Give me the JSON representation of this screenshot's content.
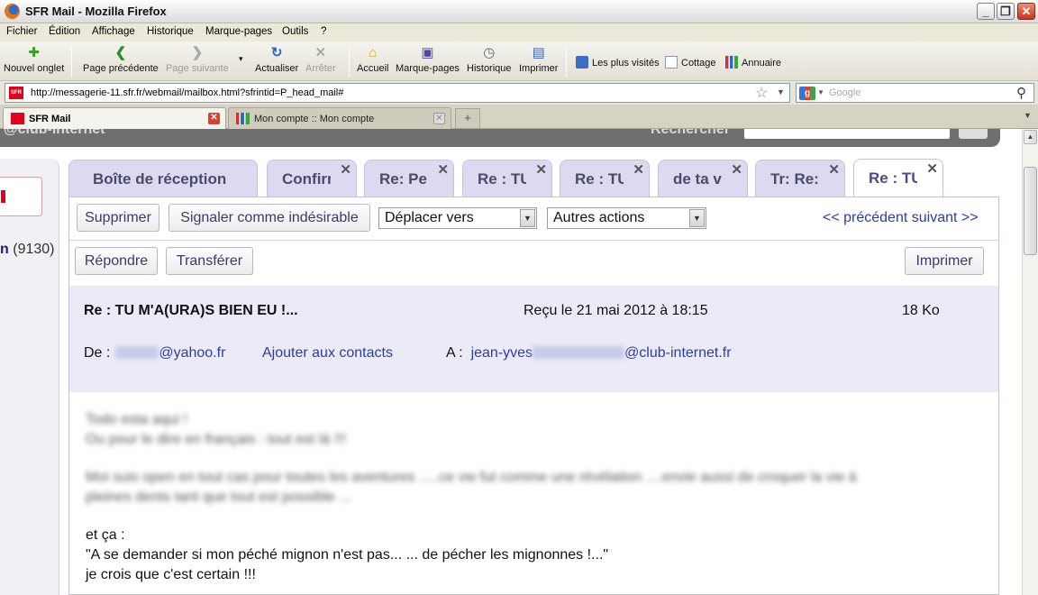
{
  "window": {
    "title": "SFR Mail - Mozilla Firefox",
    "min_label": "_",
    "max_label": "❐",
    "close_label": "✕"
  },
  "menu": {
    "items": [
      "Fichier",
      "Édition",
      "Affichage",
      "Historique",
      "Marque-pages",
      "Outils",
      "?"
    ]
  },
  "toolbar": {
    "new_tab": "Nouvel onglet",
    "back": "Page précédente",
    "forward": "Page suivante",
    "reload": "Actualiser",
    "stop": "Arrêter",
    "home": "Accueil",
    "bookmarks": "Marque-pages",
    "history": "Historique",
    "print": "Imprimer",
    "bookmarks_bar": [
      "Les plus visités",
      "Cottage",
      "Annuaire"
    ]
  },
  "urlbar": {
    "url": "http://messagerie-11.sfr.fr/webmail/mailbox.html?sfrintid=P_head_mail#",
    "search_placeholder": "Google"
  },
  "browser_tabs": [
    {
      "label": "SFR Mail",
      "active": true
    },
    {
      "label": "Mon compte :: Mon compte",
      "active": false
    }
  ],
  "sidebar": {
    "inbox_label": "n",
    "inbox_count": "(9130)"
  },
  "mail_tabs": [
    {
      "label": "Boîte de réception",
      "closable": false
    },
    {
      "label": "Confirm",
      "closable": true
    },
    {
      "label": "Re: Pers",
      "closable": true
    },
    {
      "label": "Re : TU",
      "closable": true
    },
    {
      "label": "Re : TU",
      "closable": true
    },
    {
      "label": "de ta vi",
      "closable": true
    },
    {
      "label": "Tr: Re:",
      "closable": true
    },
    {
      "label": "Re : TU",
      "closable": true,
      "current": true
    }
  ],
  "actions": {
    "delete": "Supprimer",
    "spam": "Signaler comme indésirable",
    "move_to": "Déplacer vers",
    "other_actions": "Autres actions",
    "prev_next": "<< précédent suivant >>",
    "reply": "Répondre",
    "forward": "Transférer",
    "print": "Imprimer"
  },
  "message": {
    "subject": "Re : TU M'A(URA)S BIEN EU !...",
    "received": "Reçu le 21 mai 2012 à 18:15",
    "size": "18 Ko",
    "from_label": "De :",
    "from_domain": "@yahoo.fr",
    "add_contact": "Ajouter aux contacts",
    "to_label": "A :",
    "to_prefix": "jean-yves",
    "to_domain": "@club-internet.fr",
    "blurred_lines": [
      "Todo esta aqui !",
      "Ou pour le dire en français : tout est là !!!",
      "Moi suis open en tout cas pour toutes les aventures .....ce vw fut comme une révélation ....envie aussi de croquer la vie à",
      "pleines dents tant que tout est possible ..."
    ],
    "lines": [
      "et ça :",
      "\"A se demander si mon péché mignon n'est pas... ... de pécher les mignonnes !...\"",
      "je crois que c'est certain !!!"
    ]
  },
  "colors": {
    "accent": "#2a3ea8",
    "header_bg": "#ebeaf7",
    "tab_bg": "#dcdaf0",
    "brand_red": "#e2001a"
  }
}
